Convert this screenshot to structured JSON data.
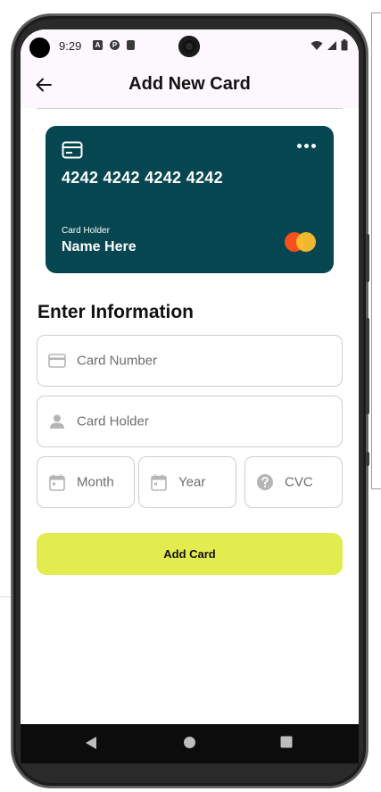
{
  "status_bar": {
    "time": "9:29",
    "left_icons": [
      "a-icon",
      "p-icon",
      "sd-card-icon"
    ],
    "right_icons": [
      "wifi-icon",
      "signal-icon",
      "battery-icon"
    ]
  },
  "app_bar": {
    "back_icon": "arrow-back-icon",
    "title": "Add New Card"
  },
  "card_preview": {
    "number": "4242 4242 4242 4242",
    "holder_label": "Card Holder",
    "holder_name": "Name Here",
    "background_color": "#064650",
    "brand_icon": "mastercard-logo"
  },
  "form": {
    "section_title": "Enter Information",
    "card_number": {
      "placeholder": "Card Number",
      "value": "",
      "icon": "credit-card-icon"
    },
    "card_holder": {
      "placeholder": "Card Holder",
      "value": "",
      "icon": "person-icon"
    },
    "month": {
      "placeholder": "Month",
      "value": "",
      "icon": "calendar-icon"
    },
    "year": {
      "placeholder": "Year",
      "value": "",
      "icon": "calendar-icon"
    },
    "cvc": {
      "placeholder": "CVC",
      "value": "",
      "icon": "help-circle-icon"
    },
    "submit_label": "Add Card",
    "submit_color": "#e2ec4f"
  },
  "nav_bar": {
    "buttons": [
      "back-triangle-icon",
      "home-circle-icon",
      "recents-square-icon"
    ]
  }
}
